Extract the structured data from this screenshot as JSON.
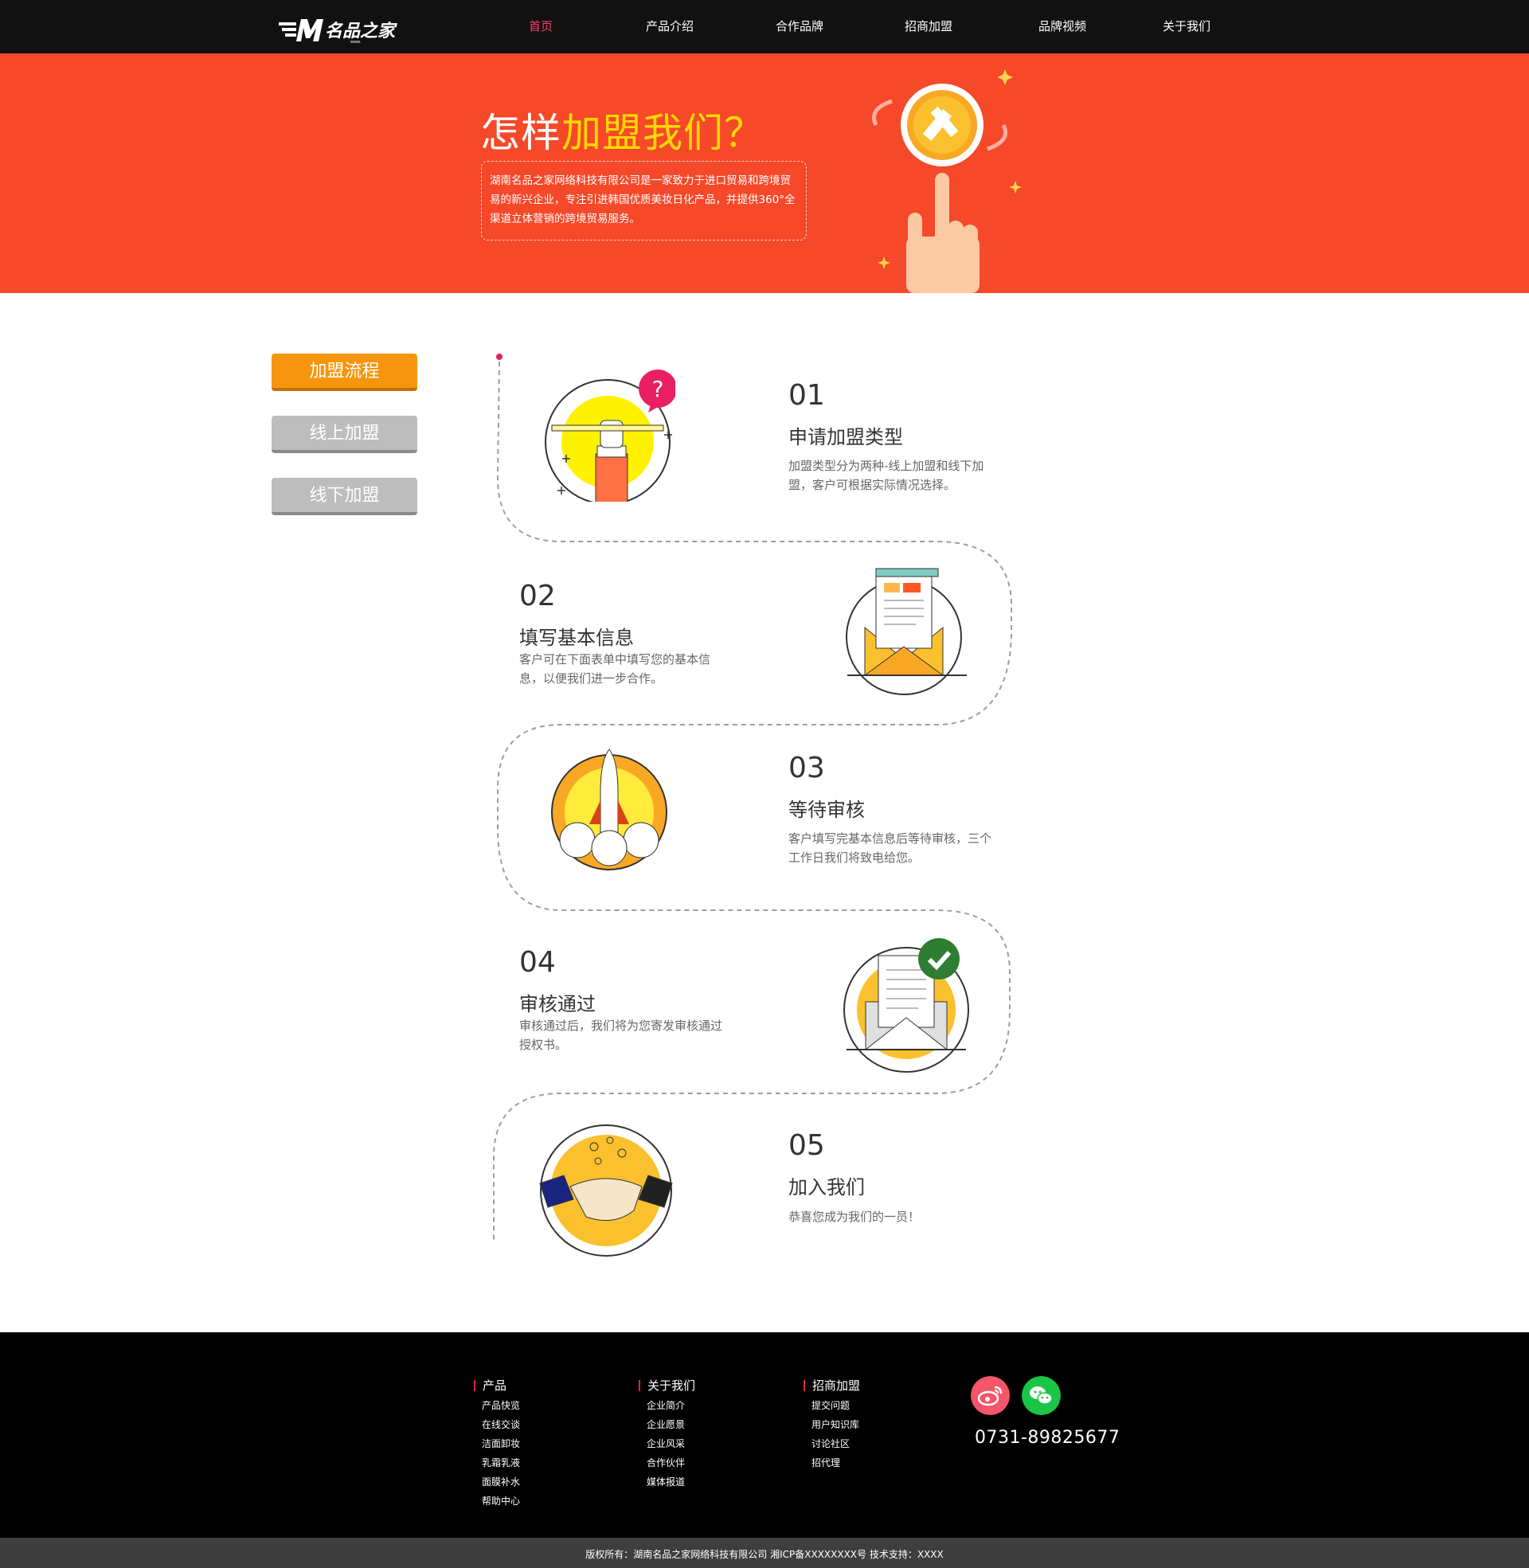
{
  "nav": {
    "logo_text": "名品之家",
    "items": [
      {
        "label": "首页",
        "active": true
      },
      {
        "label": "产品介绍"
      },
      {
        "label": "合作品牌"
      },
      {
        "label": "招商加盟"
      },
      {
        "label": "品牌视频"
      },
      {
        "label": "关于我们"
      }
    ]
  },
  "banner": {
    "title_prefix": "怎样",
    "title_highlight": "加盟我们？",
    "description": "湖南名品之家网络科技有限公司是一家致力于进口贸易和跨境贸易的新兴企业，专注引进韩国优质美妆日化产品，并提供360°全渠道立体营销的跨境贸易服务。"
  },
  "side_menu": [
    {
      "label": "加盟流程",
      "active": true
    },
    {
      "label": "线上加盟",
      "active": false
    },
    {
      "label": "线下加盟",
      "active": false
    }
  ],
  "steps": [
    {
      "num": "01",
      "title": "申请加盟类型",
      "desc": "加盟类型分为两种-线上加盟和线下加盟，客户可根据实际情况选择。",
      "icon": "hand-pencil-question-icon"
    },
    {
      "num": "02",
      "title": "填写基本信息",
      "desc": "客户可在下面表单中填写您的基本信息，以便我们进一步合作。",
      "icon": "envelope-form-icon"
    },
    {
      "num": "03",
      "title": "等待审核",
      "desc": "客户填写完基本信息后等待审核，三个工作日我们将致电给您。",
      "icon": "rocket-icon"
    },
    {
      "num": "04",
      "title": "审核通过",
      "desc": "审核通过后，我们将为您寄发审核通过授权书。",
      "icon": "envelope-check-icon"
    },
    {
      "num": "05",
      "title": "加入我们",
      "desc": "恭喜您成为我们的一员！",
      "icon": "handshake-icon"
    }
  ],
  "footer": {
    "columns": [
      {
        "title": "产品",
        "links": [
          "产品快览",
          "在线交谈",
          "洁面卸妆",
          "乳霜乳液",
          "面膜补水",
          "帮助中心"
        ]
      },
      {
        "title": "关于我们",
        "links": [
          "企业简介",
          "企业愿景",
          "企业风采",
          "合作伙伴",
          "媒体报道"
        ]
      },
      {
        "title": "招商加盟",
        "links": [
          "提交问题",
          "用户知识库",
          "讨论社区",
          "招代理"
        ]
      }
    ],
    "phone": "0731-89825677",
    "social": [
      {
        "name": "weibo-icon",
        "color": "#f5566a"
      },
      {
        "name": "wechat-icon",
        "color": "#1bc545"
      }
    ],
    "copyright": "版权所有：湖南名品之家网络科技有限公司    湘ICP备XXXXXXXX号   技术支持：XXXX"
  },
  "colors": {
    "banner_bg": "#f5492a",
    "accent_yellow": "#ffd800",
    "active_nav": "#ff3d70",
    "side_active": "#f6960e",
    "side_inactive": "#bdbdbd"
  }
}
